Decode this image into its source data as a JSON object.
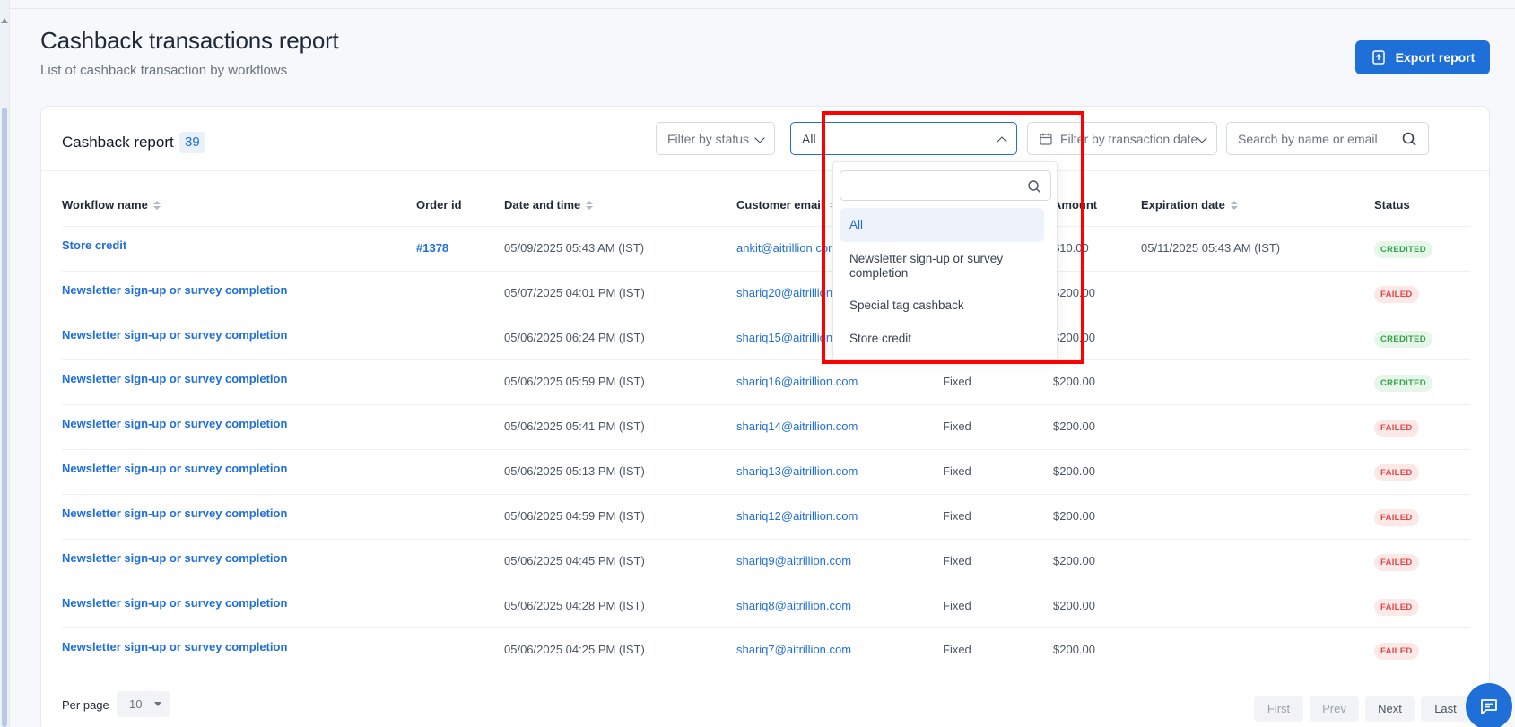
{
  "page": {
    "title": "Cashback transactions report",
    "subtitle": "List of cashback transaction by workflows",
    "export_label": "Export report"
  },
  "card": {
    "title": "Cashback report",
    "count": "39"
  },
  "filters": {
    "status_label": "Filter by status",
    "workflow_selected": "All",
    "date_label": "Filter by transaction date",
    "search_placeholder": "Search by name or email"
  },
  "dropdown": {
    "search_value": "",
    "options": [
      "All",
      "Newsletter sign-up or survey completion",
      "Special tag cashback",
      "Store credit"
    ],
    "selected": "All"
  },
  "table": {
    "headers": {
      "workflow": "Workflow name",
      "order": "Order id",
      "datetime": "Date and time",
      "email": "Customer email",
      "amount": "Amount",
      "expiration": "Expiration date",
      "status": "Status"
    },
    "rows": [
      {
        "workflow": "Store credit",
        "order": "#1378",
        "datetime": "05/09/2025 05:43 AM (IST)",
        "email": "ankit@aitrillion.con",
        "type": "",
        "amount": "$10.00",
        "expiration": "05/11/2025 05:43 AM (IST)",
        "status": "CREDITED"
      },
      {
        "workflow": "Newsletter sign-up or survey completion",
        "order": "",
        "datetime": "05/07/2025 04:01 PM (IST)",
        "email": "shariq20@aitrillion",
        "type": "",
        "amount": "$200.00",
        "expiration": "",
        "status": "FAILED"
      },
      {
        "workflow": "Newsletter sign-up or survey completion",
        "order": "",
        "datetime": "05/06/2025 06:24 PM (IST)",
        "email": "shariq15@aitrillion",
        "type": "",
        "amount": "$200.00",
        "expiration": "",
        "status": "CREDITED"
      },
      {
        "workflow": "Newsletter sign-up or survey completion",
        "order": "",
        "datetime": "05/06/2025 05:59 PM (IST)",
        "email": "shariq16@aitrillion.com",
        "type": "Fixed",
        "amount": "$200.00",
        "expiration": "",
        "status": "CREDITED"
      },
      {
        "workflow": "Newsletter sign-up or survey completion",
        "order": "",
        "datetime": "05/06/2025 05:41 PM (IST)",
        "email": "shariq14@aitrillion.com",
        "type": "Fixed",
        "amount": "$200.00",
        "expiration": "",
        "status": "FAILED"
      },
      {
        "workflow": "Newsletter sign-up or survey completion",
        "order": "",
        "datetime": "05/06/2025 05:13 PM (IST)",
        "email": "shariq13@aitrillion.com",
        "type": "Fixed",
        "amount": "$200.00",
        "expiration": "",
        "status": "FAILED"
      },
      {
        "workflow": "Newsletter sign-up or survey completion",
        "order": "",
        "datetime": "05/06/2025 04:59 PM (IST)",
        "email": "shariq12@aitrillion.com",
        "type": "Fixed",
        "amount": "$200.00",
        "expiration": "",
        "status": "FAILED"
      },
      {
        "workflow": "Newsletter sign-up or survey completion",
        "order": "",
        "datetime": "05/06/2025 04:45 PM (IST)",
        "email": "shariq9@aitrillion.com",
        "type": "Fixed",
        "amount": "$200.00",
        "expiration": "",
        "status": "FAILED"
      },
      {
        "workflow": "Newsletter sign-up or survey completion",
        "order": "",
        "datetime": "05/06/2025 04:28 PM (IST)",
        "email": "shariq8@aitrillion.com",
        "type": "Fixed",
        "amount": "$200.00",
        "expiration": "",
        "status": "FAILED"
      },
      {
        "workflow": "Newsletter sign-up or survey completion",
        "order": "",
        "datetime": "05/06/2025 04:25 PM (IST)",
        "email": "shariq7@aitrillion.com",
        "type": "Fixed",
        "amount": "$200.00",
        "expiration": "",
        "status": "FAILED"
      }
    ]
  },
  "pagination": {
    "per_page_label": "Per page",
    "per_page_value": "10",
    "first": "First",
    "prev": "Prev",
    "next": "Next",
    "last": "Last"
  },
  "colors": {
    "accent": "#1f6fd9",
    "credited": "#33a24a",
    "failed": "#e04848",
    "highlight": "#ff0000"
  }
}
